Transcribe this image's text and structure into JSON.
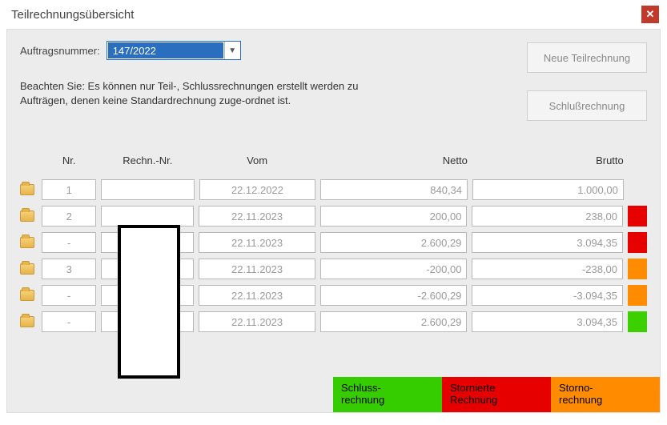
{
  "window": {
    "title": "Teilrechnungsübersicht",
    "close_glyph": "✕"
  },
  "order": {
    "label": "Auftragsnummer:",
    "value": "147/2022"
  },
  "note": "Beachten Sie: Es können nur Teil-, Schlussrechnungen erstellt werden zu Aufträgen, denen keine Standardrechnung zuge-ordnet ist.",
  "buttons": {
    "new_partial": "Neue Teilrechnung",
    "final": "Schlußrechnung"
  },
  "columns": {
    "nr": "Nr.",
    "rechnr": "Rechn.-Nr.",
    "vom": "Vom",
    "netto": "Netto",
    "brutto": "Brutto"
  },
  "rows": [
    {
      "nr": "1",
      "rechnr": "",
      "vom": "22.12.2022",
      "netto": "840,34",
      "brutto": "1.000,00",
      "status": ""
    },
    {
      "nr": "2",
      "rechnr": "",
      "vom": "22.11.2023",
      "netto": "200,00",
      "brutto": "238,00",
      "status": "red"
    },
    {
      "nr": "-",
      "rechnr": "",
      "vom": "22.11.2023",
      "netto": "2.600,29",
      "brutto": "3.094,35",
      "status": "red"
    },
    {
      "nr": "3",
      "rechnr": "",
      "vom": "22.11.2023",
      "netto": "-200,00",
      "brutto": "-238,00",
      "status": "orange"
    },
    {
      "nr": "-",
      "rechnr": "",
      "vom": "22.11.2023",
      "netto": "-2.600,29",
      "brutto": "-3.094,35",
      "status": "orange"
    },
    {
      "nr": "-",
      "rechnr": "",
      "vom": "22.11.2023",
      "netto": "2.600,29",
      "brutto": "3.094,35",
      "status": "green"
    }
  ],
  "legend": {
    "schluss": "Schluss-\nrechnung",
    "storniert": "Stornierte\nRechnung",
    "storno": "Storno-\nrechnung"
  }
}
